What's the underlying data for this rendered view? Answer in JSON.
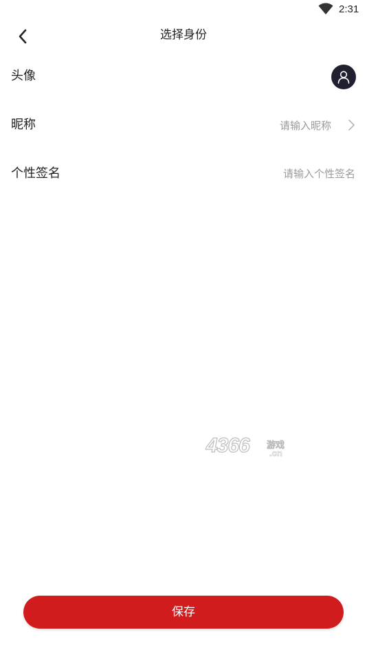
{
  "status_bar": {
    "time": "2:31",
    "wifi_icon": "wifi-icon"
  },
  "header": {
    "back_icon": "chevron-left-icon",
    "title": "选择身份"
  },
  "form": {
    "avatar": {
      "label": "头像",
      "icon": "user-icon",
      "avatar_bg": "#1f2030"
    },
    "nickname": {
      "label": "昵称",
      "placeholder": "请输入昵称",
      "chevron_icon": "chevron-right-icon"
    },
    "signature": {
      "label": "个性签名",
      "placeholder": "请输入个性签名"
    }
  },
  "watermark": {
    "number": "4366",
    "text": "游戏",
    "domain": ".cn"
  },
  "footer": {
    "save_label": "保存",
    "accent_color": "#d01c1c"
  }
}
